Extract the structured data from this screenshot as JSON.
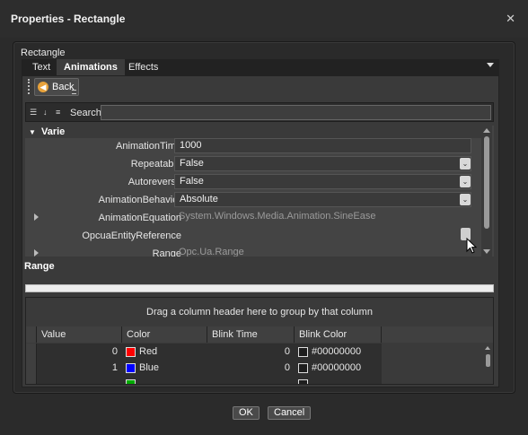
{
  "window": {
    "title": "Properties - Rectangle",
    "close_glyph": "✕"
  },
  "section": {
    "label": "Rectangle"
  },
  "tabs": [
    {
      "label": "Text",
      "active": false
    },
    {
      "label": "Animations",
      "active": true
    },
    {
      "label": "Effects",
      "active": false
    }
  ],
  "toolbar": {
    "back_label": "Back",
    "back_icon": "back-arrow-icon"
  },
  "search": {
    "label": "Search:",
    "value": ""
  },
  "property_grid": {
    "category": "Varie",
    "rows": [
      {
        "name": "AnimationTime",
        "value": "1000",
        "editor": "text"
      },
      {
        "name": "Repeatable",
        "value": "False",
        "editor": "combo"
      },
      {
        "name": "Autoreverse",
        "value": "False",
        "editor": "combo"
      },
      {
        "name": "AnimationBehavior",
        "value": "Absolute",
        "editor": "combo"
      },
      {
        "name": "AnimationEquation",
        "value": "System.Windows.Media.Animation.SineEase",
        "editor": "expandable"
      },
      {
        "name": "OpcuaEntityReference",
        "value": "",
        "editor": "ellipsis"
      },
      {
        "name": "Range",
        "value": "Opc.Ua.Range",
        "editor": "expandable"
      }
    ]
  },
  "range": {
    "label": "Range"
  },
  "datagrid": {
    "group_hint": "Drag a column header here to group by that column",
    "columns": [
      "Value",
      "Color",
      "Blink Time",
      "Blink Color"
    ],
    "rows": [
      {
        "value": "0",
        "color_name": "Red",
        "color_hex": "#ff0000",
        "blink_time": "0",
        "blink_color": "#00000000"
      },
      {
        "value": "1",
        "color_name": "Blue",
        "color_hex": "#0000ff",
        "blink_time": "0",
        "blink_color": "#00000000"
      }
    ]
  },
  "footer": {
    "ok_label": "OK",
    "cancel_label": "Cancel"
  }
}
